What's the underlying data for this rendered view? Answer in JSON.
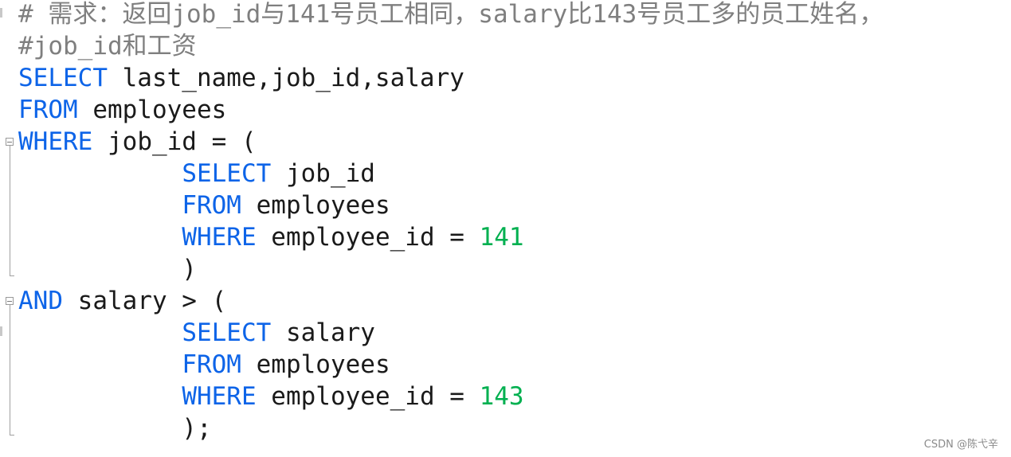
{
  "editor": {
    "language": "sql",
    "lines": [
      {
        "tokens": [
          {
            "t": "comment",
            "v": "# 需求：返回job_id与141号员工相同，salary比143号员工多的员工姓名，"
          }
        ]
      },
      {
        "tokens": [
          {
            "t": "comment",
            "v": "#job_id和工资"
          }
        ]
      },
      {
        "tokens": [
          {
            "t": "kw",
            "v": "SELECT"
          },
          {
            "t": "plain",
            "v": " last_name,job_id,salary"
          }
        ]
      },
      {
        "tokens": [
          {
            "t": "kw",
            "v": "FROM"
          },
          {
            "t": "plain",
            "v": " employees"
          }
        ]
      },
      {
        "tokens": [
          {
            "t": "kw",
            "v": "WHERE"
          },
          {
            "t": "plain",
            "v": " job_id = ("
          }
        ]
      },
      {
        "tokens": [
          {
            "t": "plain",
            "v": "           "
          },
          {
            "t": "kw",
            "v": "SELECT"
          },
          {
            "t": "plain",
            "v": " job_id"
          }
        ]
      },
      {
        "tokens": [
          {
            "t": "plain",
            "v": "           "
          },
          {
            "t": "kw",
            "v": "FROM"
          },
          {
            "t": "plain",
            "v": " employees"
          }
        ]
      },
      {
        "tokens": [
          {
            "t": "plain",
            "v": "           "
          },
          {
            "t": "kw",
            "v": "WHERE"
          },
          {
            "t": "plain",
            "v": " employee_id = "
          },
          {
            "t": "num",
            "v": "141"
          }
        ]
      },
      {
        "tokens": [
          {
            "t": "plain",
            "v": "           )"
          }
        ]
      },
      {
        "tokens": [
          {
            "t": "kw",
            "v": "AND"
          },
          {
            "t": "plain",
            "v": " salary > ("
          }
        ]
      },
      {
        "tokens": [
          {
            "t": "plain",
            "v": "           "
          },
          {
            "t": "kw",
            "v": "SELECT"
          },
          {
            "t": "plain",
            "v": " salary"
          }
        ]
      },
      {
        "tokens": [
          {
            "t": "plain",
            "v": "           "
          },
          {
            "t": "kw",
            "v": "FROM"
          },
          {
            "t": "plain",
            "v": " employees"
          }
        ]
      },
      {
        "tokens": [
          {
            "t": "plain",
            "v": "           "
          },
          {
            "t": "kw",
            "v": "WHERE"
          },
          {
            "t": "plain",
            "v": " employee_id = "
          },
          {
            "t": "num",
            "v": "143"
          }
        ]
      },
      {
        "tokens": [
          {
            "t": "plain",
            "v": "           );"
          }
        ]
      }
    ],
    "folds": [
      {
        "start": 4,
        "end": 8
      },
      {
        "start": 9,
        "end": 13
      }
    ]
  },
  "colors": {
    "keyword": "#0d64e8",
    "number": "#00b050",
    "comment": "#7f7f7f",
    "text": "#1a1a1a"
  },
  "watermark": "CSDN @陈弋辛"
}
